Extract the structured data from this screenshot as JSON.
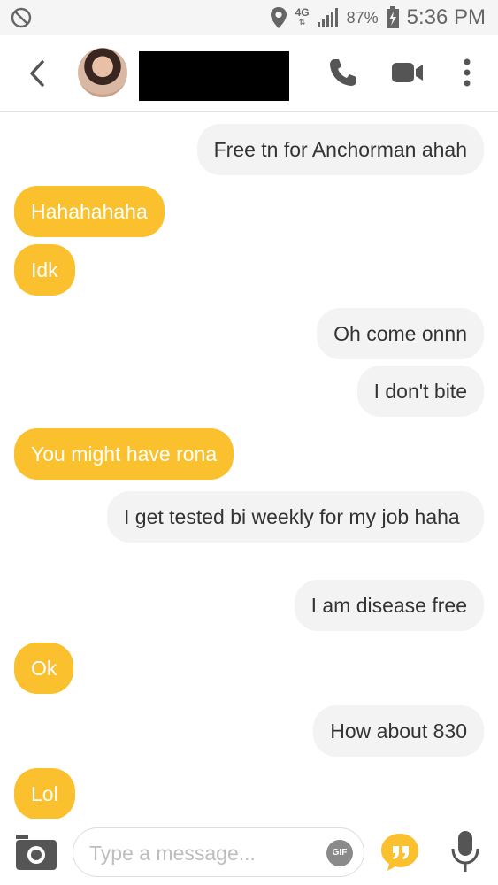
{
  "status_bar": {
    "network": "4G",
    "battery": "87%",
    "time": "5:36 PM"
  },
  "messages": [
    {
      "side": "out",
      "text": "Free tn for Anchorman ahah"
    },
    {
      "side": "in",
      "text": "Hahahahaha"
    },
    {
      "side": "in",
      "text": "Idk"
    },
    {
      "side": "out",
      "text": "Oh come onnn"
    },
    {
      "side": "out",
      "text": "I don't bite"
    },
    {
      "side": "in",
      "text": "You might have rona"
    },
    {
      "side": "out",
      "text": "I get tested bi weekly for my job haha"
    },
    {
      "side": "out",
      "text": "I am disease free"
    },
    {
      "side": "in",
      "text": "Ok"
    },
    {
      "side": "out",
      "text": "How about 830"
    },
    {
      "side": "in",
      "text": "Lol"
    }
  ],
  "composer": {
    "placeholder": "Type a message...",
    "gif_label": "GIF"
  },
  "colors": {
    "incoming_bubble": "#fbc02d",
    "outgoing_bubble": "#f3f3f3"
  }
}
